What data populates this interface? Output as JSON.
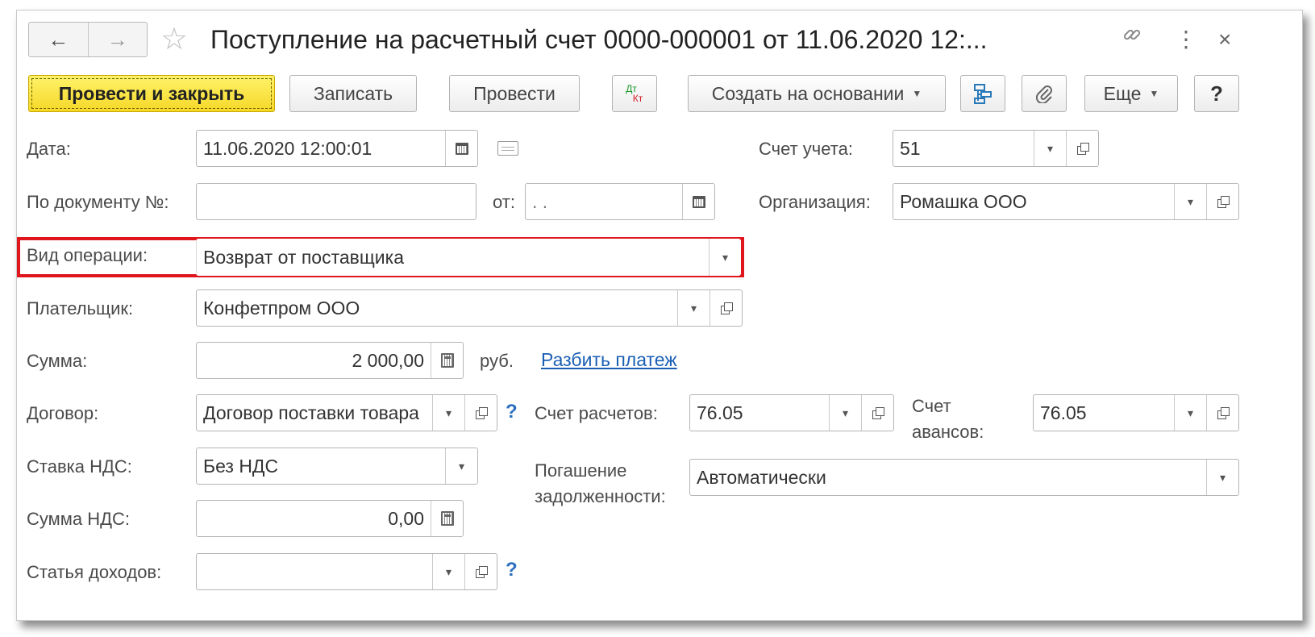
{
  "window": {
    "title": "Поступление на расчетный счет 0000-000001 от 11.06.2020 12:...",
    "nav_back": "←",
    "nav_forward": "→",
    "star_glyph": "☆",
    "link_glyph": "🔗",
    "more_glyph": "⋮",
    "close_glyph": "×"
  },
  "toolbar": {
    "post_and_close": "Провести и закрыть",
    "save": "Записать",
    "post": "Провести",
    "dtkt_top": "Дт",
    "dtkt_bottom": "Кт",
    "create_based_on": "Создать на основании",
    "more": "Еще",
    "help": "?"
  },
  "form": {
    "date": {
      "label": "Дата:",
      "value": "11.06.2020 12:00:01"
    },
    "doc_number": {
      "label": "По документу №:",
      "value": ""
    },
    "doc_from": {
      "label": "от:",
      "value": " .  ."
    },
    "account": {
      "label": "Счет учета:",
      "value": "51"
    },
    "organization": {
      "label": "Организация:",
      "value": "Ромашка ООО"
    },
    "operation_type": {
      "label": "Вид операции:",
      "value": "Возврат от поставщика"
    },
    "payer": {
      "label": "Плательщик:",
      "value": "Конфетпром ООО"
    },
    "amount": {
      "label": "Сумма:",
      "value": "2 000,00",
      "currency": "руб.",
      "split_link": "Разбить платеж"
    },
    "contract": {
      "label": "Договор:",
      "value": "Договор поставки товара"
    },
    "settlement_account": {
      "label": "Счет расчетов:",
      "value": "76.05"
    },
    "advance_account": {
      "label_line1": "Счет",
      "label_line2": "авансов:",
      "value": "76.05"
    },
    "vat_rate": {
      "label": "Ставка НДС:",
      "value": "Без НДС"
    },
    "debt_repayment": {
      "label_line1": "Погашение",
      "label_line2": "задолженности:",
      "value": "Автоматически"
    },
    "vat_amount": {
      "label": "Сумма НДС:",
      "value": "0,00"
    },
    "income_item": {
      "label": "Статья доходов:",
      "value": ""
    },
    "help_mark": "?"
  },
  "colors": {
    "primary_button": "#f5d828",
    "highlight_border": "#e0161c",
    "link": "#1a5fb4"
  }
}
